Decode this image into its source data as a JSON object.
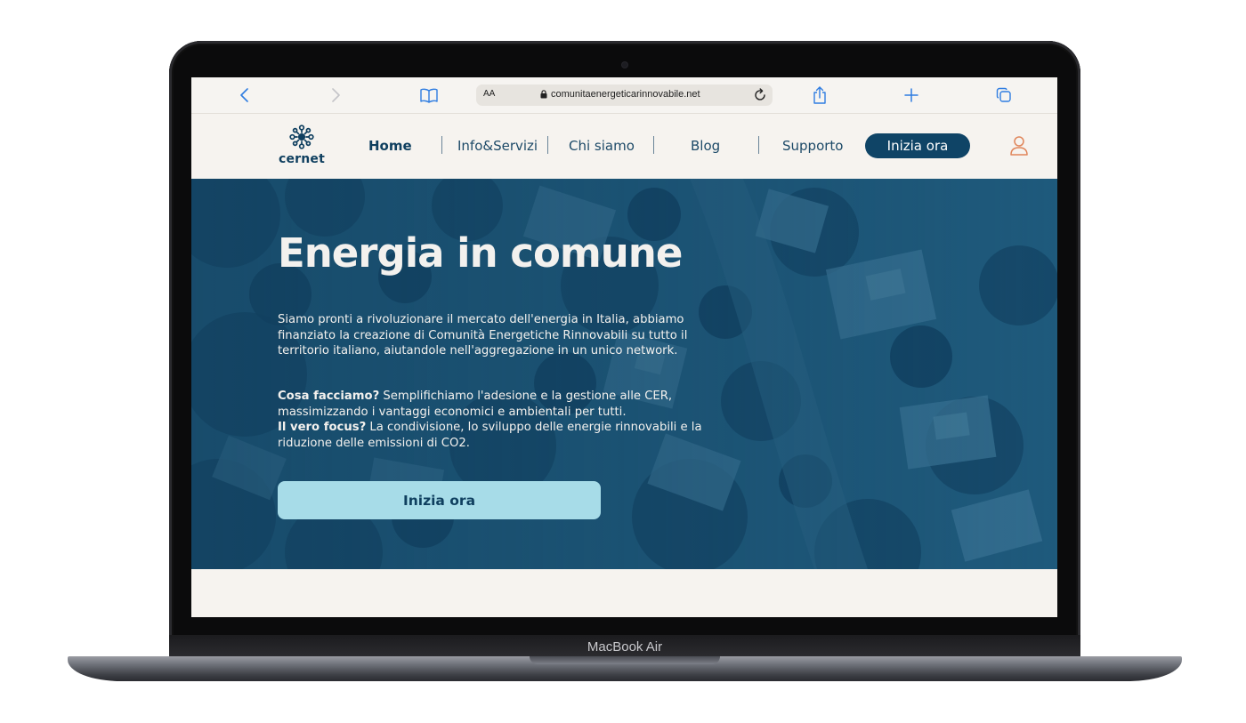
{
  "device": {
    "label": "MacBook Air"
  },
  "browser": {
    "address_prefix": "AA",
    "url": "comunitaenergeticarinnovabile.net",
    "buttons": [
      "back-icon",
      "forward-icon",
      "bookmarks-icon",
      "reload-icon",
      "share-icon",
      "new-tab-icon",
      "tabs-icon"
    ]
  },
  "site": {
    "logo_text": "cernet",
    "nav": {
      "items": [
        {
          "label": "Home",
          "active": true
        },
        {
          "label": "Info&Servizi",
          "active": false
        },
        {
          "label": "Chi siamo",
          "active": false
        },
        {
          "label": "Blog",
          "active": false
        },
        {
          "label": "Supporto",
          "active": false
        }
      ],
      "cta_label": "Inizia ora"
    },
    "hero": {
      "title": "Energia in comune",
      "intro": "Siamo pronti a rivoluzionare il mercato dell'energia in Italia, abbiamo finanziato la creazione di Comunità Energetiche Rinnovabili su tutto il territorio italiano, aiutandole nell'aggregazione in un unico network.",
      "q1": "Cosa facciamo?",
      "a1": " Semplifichiamo l'adesione e la gestione alle CER, massimizzando i vantaggi economici e ambientali per tutti.",
      "q2": "Il vero focus?",
      "a2": " La condivisione, lo sviluppo delle energie rinnovabili e la riduzione delle emissioni di CO2.",
      "cta_label": "Inizia ora"
    }
  },
  "colors": {
    "brand_dark": "#0f4466",
    "hero_overlay": "#1f5a7c",
    "cta_light": "#a7dce8",
    "user_icon": "#e0855a",
    "safari_blue": "#2f7de1"
  }
}
